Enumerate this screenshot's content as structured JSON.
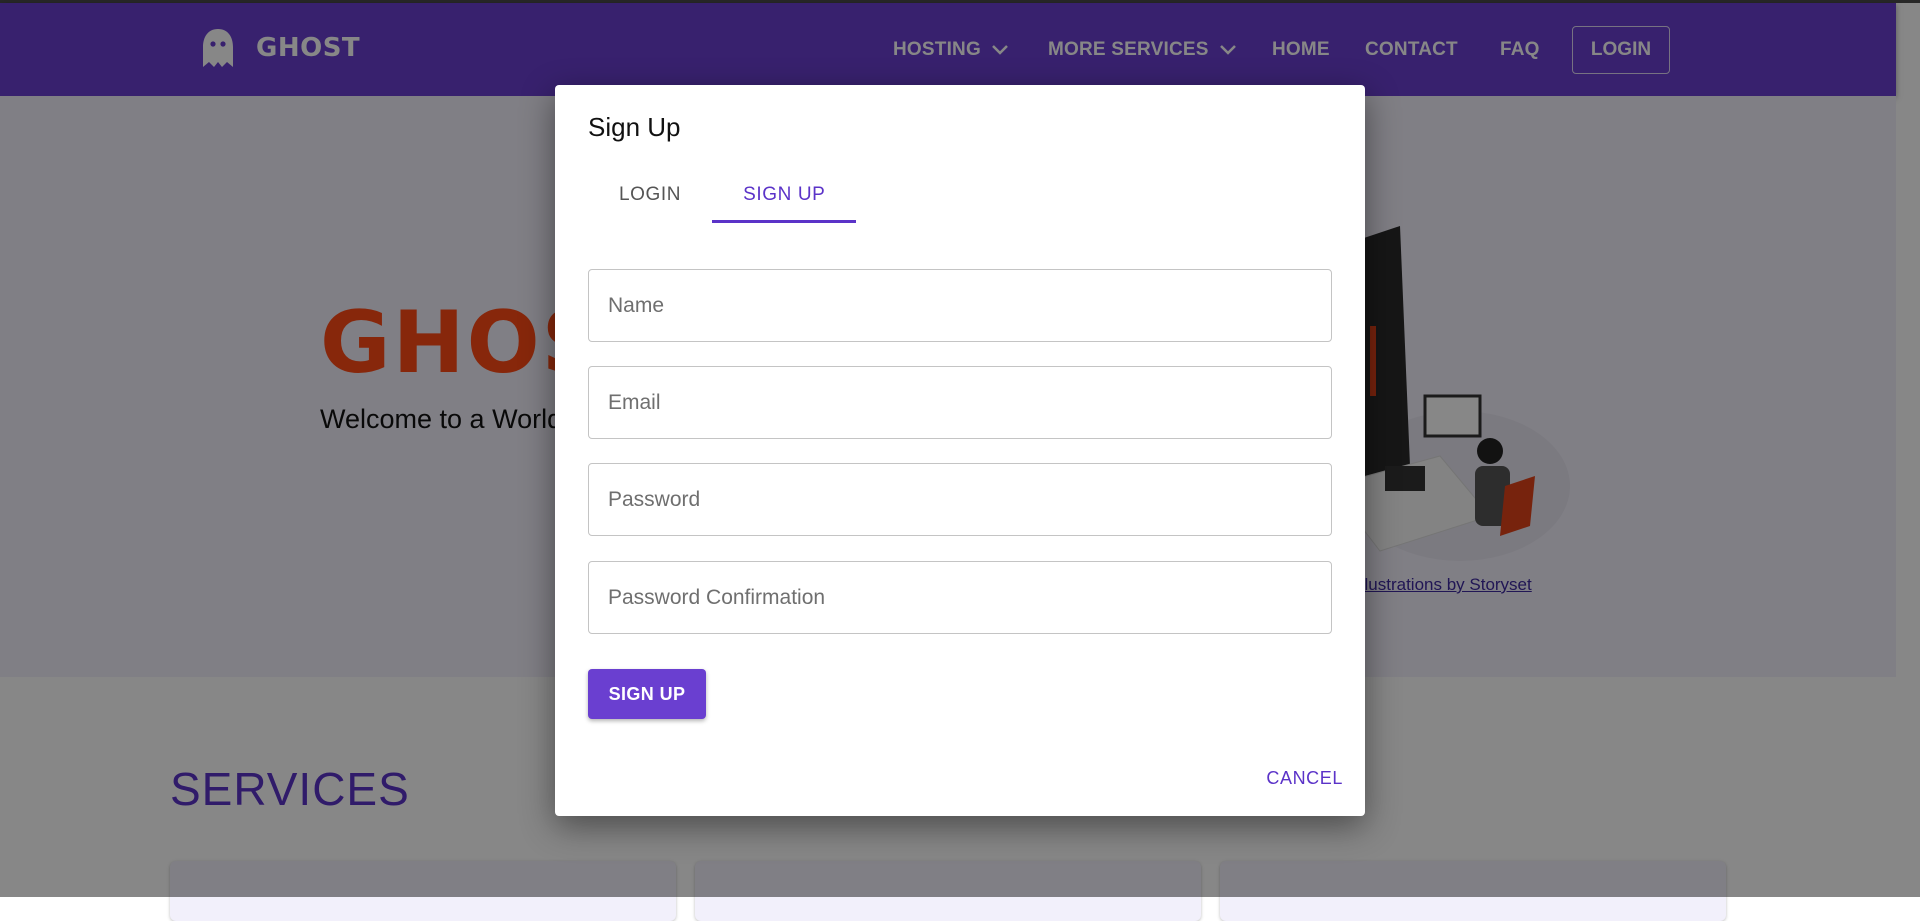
{
  "nav": {
    "brand": "GHOST",
    "items": [
      {
        "label": "HOSTING",
        "dropdown": true
      },
      {
        "label": "MORE SERVICES",
        "dropdown": true
      },
      {
        "label": "HOME"
      },
      {
        "label": "CONTACT"
      },
      {
        "label": "FAQ"
      }
    ],
    "login_label": "LOGIN"
  },
  "hero": {
    "title": "GHOST",
    "subtitle": "Welcome to a World Meets Excellence, a",
    "credit": "Illustrations by Storyset"
  },
  "services": {
    "title": "SERVICES"
  },
  "modal": {
    "title": "Sign Up",
    "tabs": [
      {
        "label": "LOGIN",
        "active": false
      },
      {
        "label": "SIGN UP",
        "active": true
      }
    ],
    "fields": {
      "name": {
        "placeholder": "Name",
        "value": ""
      },
      "email": {
        "placeholder": "Email",
        "value": ""
      },
      "password": {
        "placeholder": "Password",
        "value": ""
      },
      "password_confirmation": {
        "placeholder": "Password Confirmation",
        "value": ""
      }
    },
    "submit_label": "SIGN UP",
    "cancel_label": "CANCEL"
  },
  "colors": {
    "brand": "#6a3fd0",
    "accent_text": "#5b33c8",
    "hero_title": "#ff4a16"
  },
  "icons": {
    "brand": "ghost-icon",
    "dropdown": "chevron-down-icon"
  }
}
